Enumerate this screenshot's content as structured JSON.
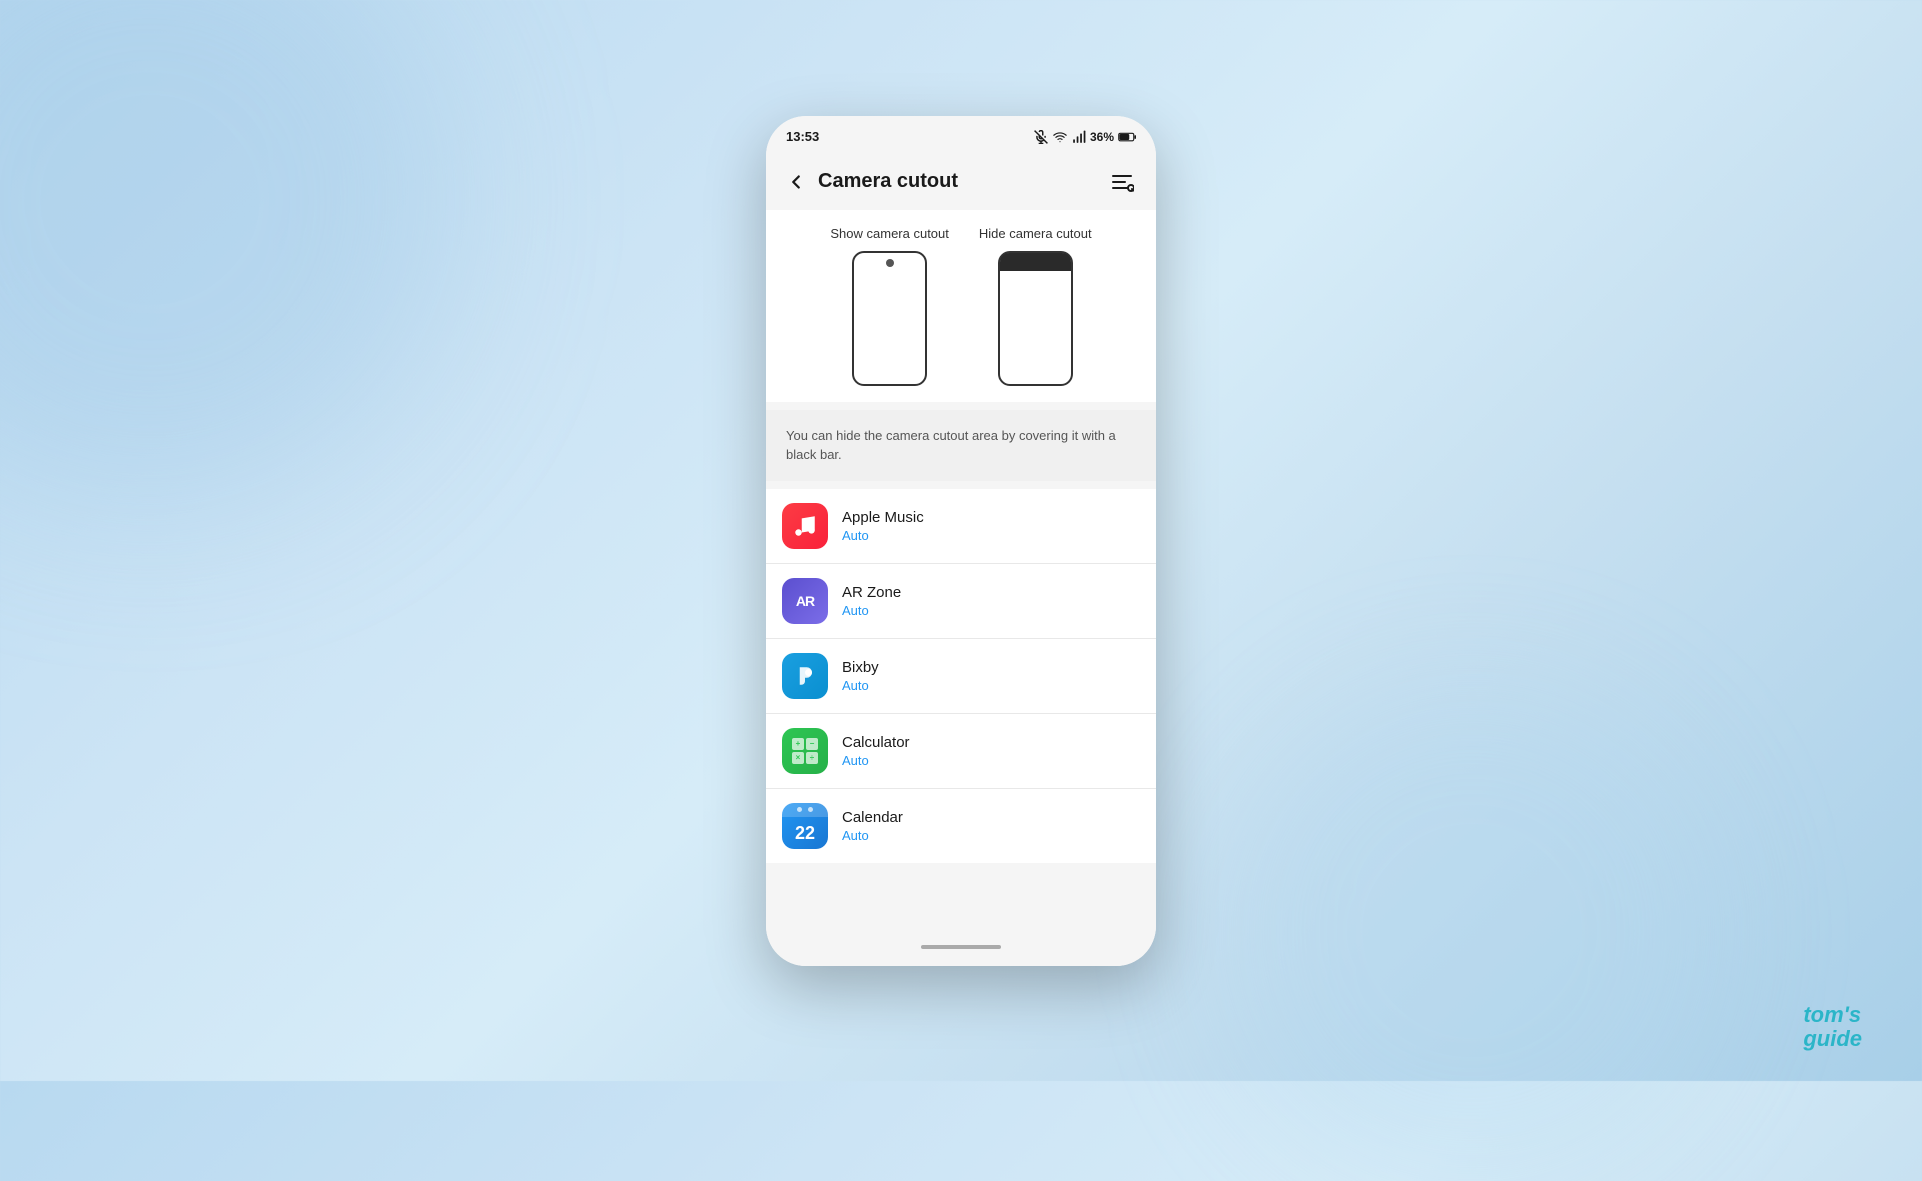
{
  "background": {
    "color": "#b8d9f0"
  },
  "statusBar": {
    "time": "13:53",
    "battery": "36%"
  },
  "header": {
    "title": "Camera cutout",
    "backLabel": "back",
    "searchLabel": "search"
  },
  "cutoutSection": {
    "showLabel": "Show camera cutout",
    "hideLabel": "Hide camera cutout"
  },
  "description": "You can hide the camera cutout area by covering it with a black bar.",
  "apps": [
    {
      "name": "Apple Music",
      "status": "Auto",
      "iconType": "apple-music"
    },
    {
      "name": "AR Zone",
      "status": "Auto",
      "iconType": "ar-zone"
    },
    {
      "name": "Bixby",
      "status": "Auto",
      "iconType": "bixby"
    },
    {
      "name": "Calculator",
      "status": "Auto",
      "iconType": "calculator"
    },
    {
      "name": "Calendar",
      "status": "Auto",
      "iconType": "calendar"
    }
  ],
  "watermark": {
    "line1": "tom's",
    "line2": "guide"
  }
}
